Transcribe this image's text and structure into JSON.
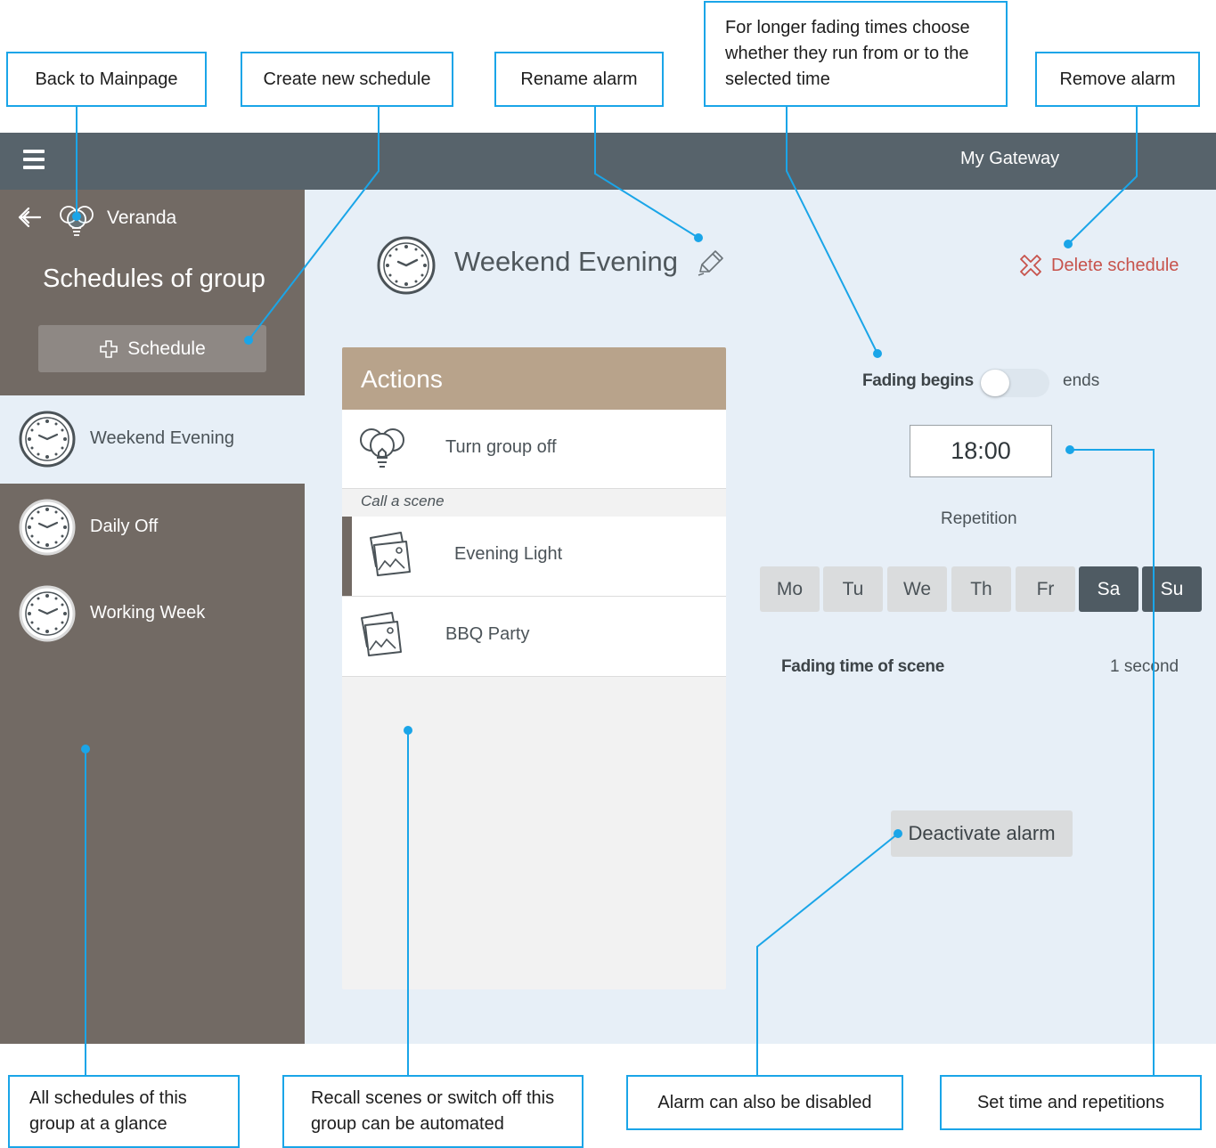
{
  "app": {
    "gateway_title": "My Gateway",
    "group_name": "Veranda",
    "sidebar_heading": "Schedules of group",
    "add_schedule_label": "Schedule",
    "schedules": [
      {
        "label": "Weekend Evening",
        "active": true
      },
      {
        "label": "Daily Off",
        "active": false
      },
      {
        "label": "Working Week",
        "active": false
      }
    ],
    "schedule_title": "Weekend Evening",
    "delete_label": "Delete schedule",
    "actions": {
      "title": "Actions",
      "turn_off_label": "Turn group off",
      "section_label": "Call a scene",
      "scenes": [
        "Evening Light",
        "BBQ Party"
      ]
    },
    "fading": {
      "begins_label": "Fading begins",
      "ends_label": "ends",
      "toggle_state": "begins"
    },
    "time_value": "18:00",
    "repetition_label": "Repetition",
    "days": [
      {
        "label": "Mo",
        "selected": false
      },
      {
        "label": "Tu",
        "selected": false
      },
      {
        "label": "We",
        "selected": false
      },
      {
        "label": "Th",
        "selected": false
      },
      {
        "label": "Fr",
        "selected": false
      },
      {
        "label": "Sa",
        "selected": true
      },
      {
        "label": "Su",
        "selected": true
      }
    ],
    "fading_time_label": "Fading time of scene",
    "fading_time_value": "1 second",
    "deactivate_label": "Deactivate alarm"
  },
  "callouts": {
    "back": "Back to Mainpage",
    "create": "Create new schedule",
    "rename": "Rename alarm",
    "fading": "For longer fading times choose whether they run from or to the selected time",
    "remove": "Remove alarm",
    "all_schedules": "All schedules of this group at a glance",
    "recall": "Recall scenes or switch off this group can be automated",
    "disabled": "Alarm can also be disabled",
    "set_time": "Set time and repetitions"
  },
  "colors": {
    "topbar": "#57636b",
    "sidebar": "#726a64",
    "main_bg": "#e7eff7",
    "actions_header": "#b8a38b",
    "delete": "#c7534c",
    "callout_border": "#1aa5e8",
    "day_selected": "#4f5b63"
  },
  "icons": [
    "hamburger-icon",
    "back-arrow-icon",
    "bulb-group-icon",
    "plus-icon",
    "clock-icon",
    "pencil-icon",
    "delete-x-icon",
    "scene-image-icon"
  ]
}
